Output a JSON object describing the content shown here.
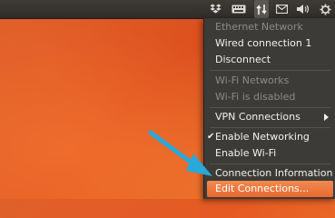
{
  "panel": {
    "indicators": [
      "dropbox-icon",
      "keyboard-icon",
      "network-icon",
      "mail-icon",
      "volume-icon",
      "system-gear-icon"
    ]
  },
  "network_menu": {
    "items": [
      {
        "label": "Ethernet Network",
        "enabled": false
      },
      {
        "label": "Wired connection 1",
        "enabled": true
      },
      {
        "label": "Disconnect",
        "enabled": true
      },
      {
        "label": "Wi-Fi Networks",
        "enabled": false
      },
      {
        "label": "Wi-Fi is disabled",
        "enabled": false
      },
      {
        "label": "VPN Connections",
        "enabled": true,
        "submenu": true
      },
      {
        "label": "Enable Networking",
        "enabled": true,
        "checked": true,
        "check_mark": "✔"
      },
      {
        "label": "Enable Wi-Fi",
        "enabled": true
      },
      {
        "label": "Connection Information",
        "enabled": true
      },
      {
        "label": "Edit Connections...",
        "enabled": true,
        "highlighted": true
      }
    ]
  },
  "colors": {
    "panel": "#3e3b37",
    "menu_bg": "#3c3b37",
    "menu_text": "#f2f1f0",
    "menu_disabled": "#8b8a86",
    "highlight": "#e86a2f",
    "annotation_arrow": "#2aa8d8",
    "desktop": "#e55a23"
  }
}
